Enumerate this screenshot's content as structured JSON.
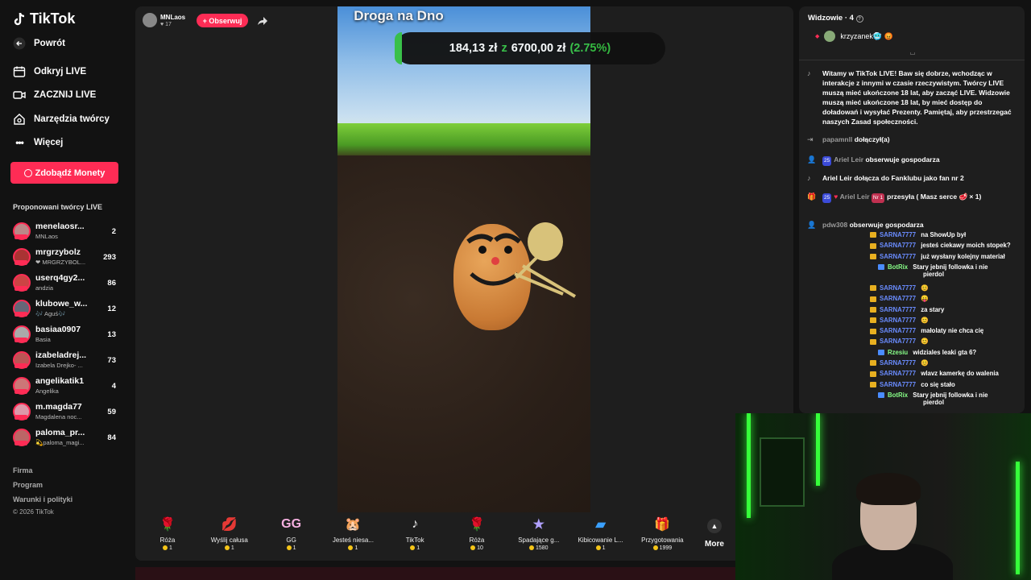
{
  "app": {
    "logo": "TikTok"
  },
  "sidebar": {
    "back": "Powrót",
    "nav": [
      {
        "label": "Odkryj LIVE",
        "icon": "live-calendar-icon"
      },
      {
        "label": "ZACZNIJ LIVE",
        "icon": "camera-icon"
      },
      {
        "label": "Narzędzia twórcy",
        "icon": "creator-tools-icon"
      },
      {
        "label": "Więcej",
        "icon": "more-dots-icon"
      }
    ],
    "coins_button": "Zdobądź Monety",
    "suggested_title": "Proponowani twórcy LIVE",
    "creators": [
      {
        "name": "menelaosr...",
        "sub": "MNLaos",
        "count": "2"
      },
      {
        "name": "mrgrzybolz",
        "sub": "❤ MRGRZYBOL...",
        "count": "293"
      },
      {
        "name": "userq4gy2...",
        "sub": "andzia",
        "count": "86"
      },
      {
        "name": "klubowe_w...",
        "sub": "🎶 Aguś🎶",
        "count": "12"
      },
      {
        "name": "basiaa0907",
        "sub": "Basia",
        "count": "13"
      },
      {
        "name": "izabeladrej...",
        "sub": "Izabela Drejko- ...",
        "count": "73"
      },
      {
        "name": "angelikatik1",
        "sub": "Angelika",
        "count": "4"
      },
      {
        "name": "m.magda77",
        "sub": "Magdalena noc...",
        "count": "59"
      },
      {
        "name": "paloma_pr...",
        "sub": "💫paloma_magi...",
        "count": "84"
      }
    ],
    "footer": [
      "Firma",
      "Program",
      "Warunki i polityki",
      "© 2026 TikTok"
    ]
  },
  "stream": {
    "host_name": "MNLaos",
    "host_likes": "♥ 17",
    "follow_label": "+ Obserwuj",
    "overlay_title": "Droga na Dno",
    "goal": {
      "current": "184,13 zł",
      "connector": "z",
      "target": "6700,00 zł",
      "percent_label": "(2.75%)",
      "progress": 0.0275
    }
  },
  "gifts": [
    {
      "name": "Róża",
      "price": "1",
      "icon": "🌹"
    },
    {
      "name": "Wyślij całusa",
      "price": "1",
      "icon": "💋"
    },
    {
      "name": "GG",
      "price": "1",
      "icon": "GG"
    },
    {
      "name": "Jesteś niesa...",
      "price": "1",
      "icon": "🐹"
    },
    {
      "name": "TikTok",
      "price": "1",
      "icon": "♪"
    },
    {
      "name": "Róża",
      "price": "10",
      "icon": "🌹"
    },
    {
      "name": "Spadające g...",
      "price": "1580",
      "icon": "★"
    },
    {
      "name": "Kibicowanie L...",
      "price": "1",
      "icon": "▰"
    },
    {
      "name": "Przygotowania",
      "price": "1999",
      "icon": "🎁"
    }
  ],
  "gifts_more": "More",
  "chat": {
    "header": "Widzowie · 4",
    "top_viewer": "krzyzanek🥶 😡",
    "welcome": "Witamy w TikTok LIVE! Baw się dobrze, wchodząc w interakcje z innymi w czasie rzeczywistym. Twórcy LIVE muszą mieć ukończone 18 lat, aby zacząć LIVE. Widzowie muszą mieć ukończone 18 lat, by mieć dostęp do doładowań i wysyłać Prezenty. Pamiętaj, aby przestrzegać naszych Zasad społeczności.",
    "events": [
      {
        "user": "papamnll",
        "text": "dołączył(a)"
      },
      {
        "badge": "25",
        "user": "Ariel Leir",
        "text": "obserwuje gospodarza"
      },
      {
        "user": "Ariel Leir dołącza do Fanklubu jako fan nr 2",
        "text": ""
      },
      {
        "badge": "25",
        "user": "Ariel Leir",
        "text": "przesyła ( Masz serce 🥩 × 1)",
        "extra": "Nr 1"
      },
      {
        "user": "pdw308",
        "text": "obserwuje gospodarza"
      }
    ]
  },
  "overlay_chat": [
    {
      "user": "SARNA7777",
      "text": "na ShowUp był"
    },
    {
      "user": "SARNA7777",
      "text": "jesteś ciekawy moich stopek?"
    },
    {
      "user": "SARNA7777",
      "text": "już wysłany kolejny materiał"
    },
    {
      "user": "BotRix",
      "text": "Stary jebnij followka i nie",
      "text2": "pierdol",
      "bot": true
    },
    {
      "user": "SARNA7777",
      "text": "😊"
    },
    {
      "user": "SARNA7777",
      "text": "😛"
    },
    {
      "user": "SARNA7777",
      "text": "za stary"
    },
    {
      "user": "SARNA7777",
      "text": "😊"
    },
    {
      "user": "SARNA7777",
      "text": "małolaty nie chca cię"
    },
    {
      "user": "SARNA7777",
      "text": "😊"
    },
    {
      "user": "Rzesiu",
      "text": "widziales leaki gta 6?",
      "bot": true
    },
    {
      "user": "SARNA7777",
      "text": "😊"
    },
    {
      "user": "SARNA7777",
      "text": "wlavz kamerkę do walenia"
    },
    {
      "user": "SARNA7777",
      "text": "co się stało"
    },
    {
      "user": "BotRix",
      "text": "Stary jebnij followka i nie",
      "text2": "pierdol",
      "bot": true
    }
  ],
  "colors": {
    "accent": "#fe2c55",
    "goal_green": "#36c142",
    "bg": "#121212"
  }
}
